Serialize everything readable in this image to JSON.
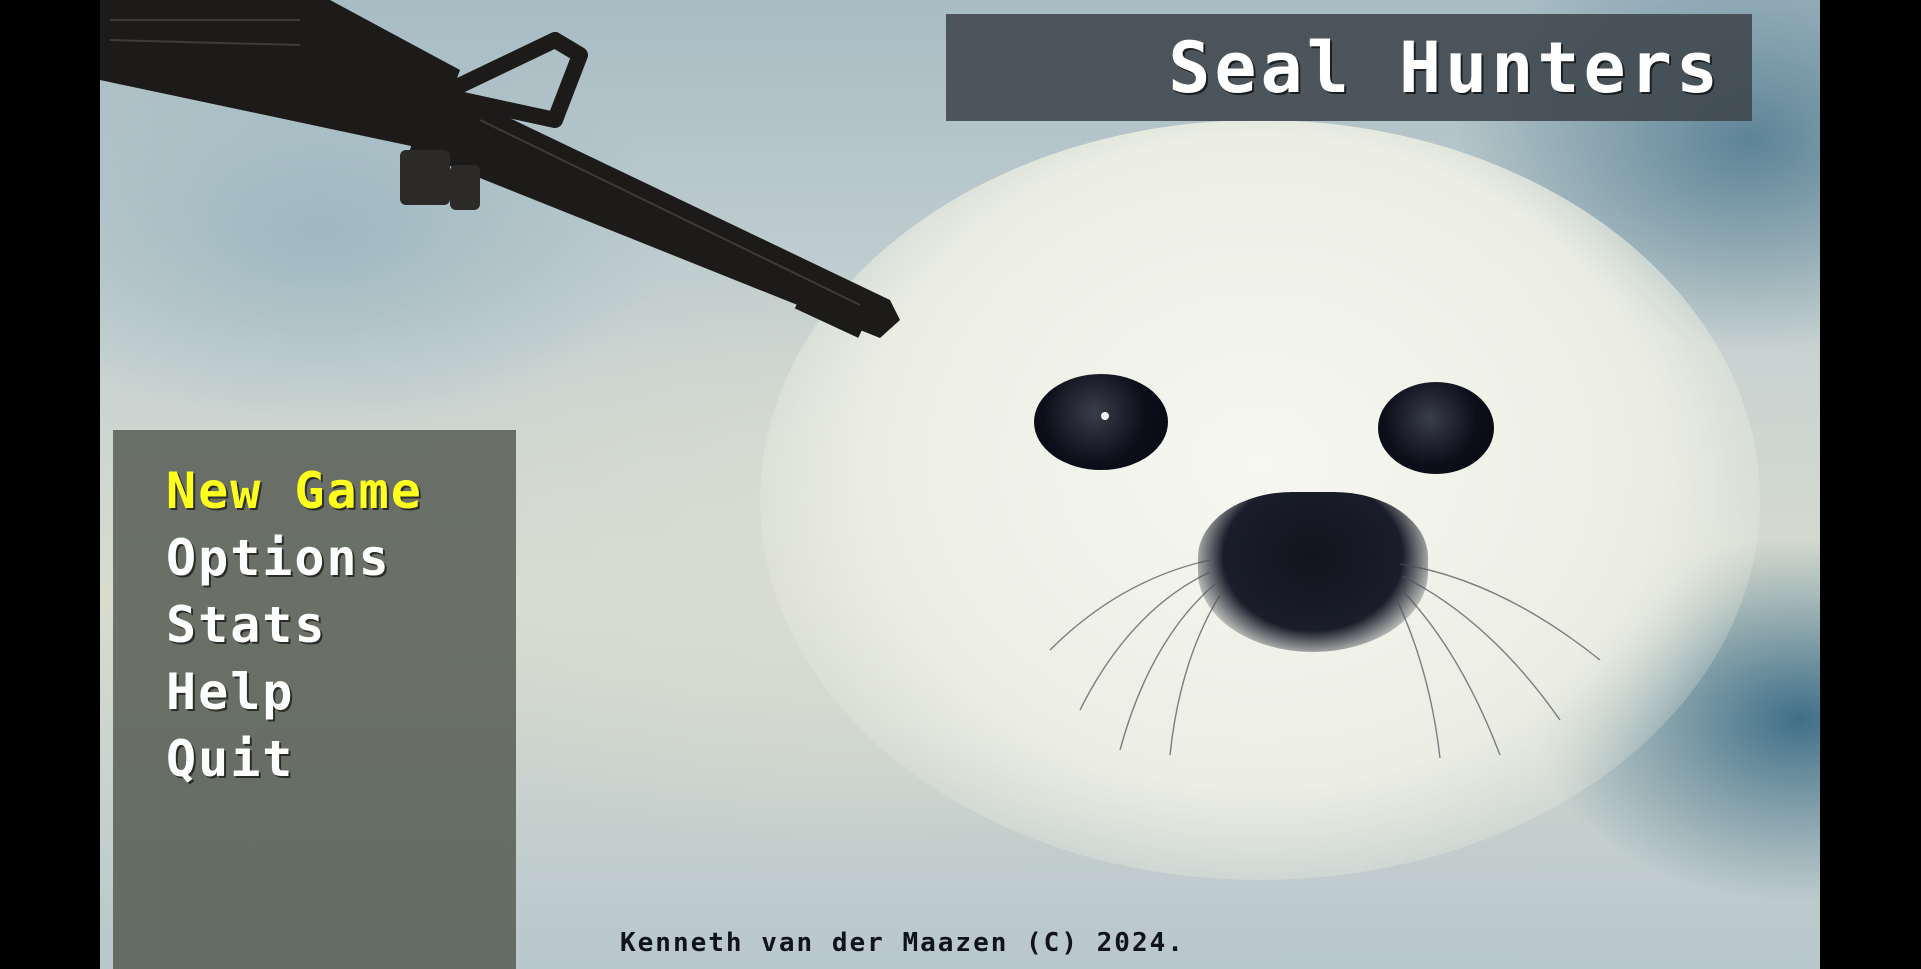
{
  "game": {
    "title": "Seal Hunters",
    "menu": {
      "items": [
        {
          "label": "New Game",
          "selected": true
        },
        {
          "label": "Options",
          "selected": false
        },
        {
          "label": "Stats",
          "selected": false
        },
        {
          "label": "Help",
          "selected": false
        },
        {
          "label": "Quit",
          "selected": false
        }
      ]
    },
    "footer": "Kenneth van der Maazen (C) 2024."
  },
  "colors": {
    "selected_menu_item": "#ffff1e",
    "menu_item": "#ffffff",
    "title_text": "#ffffff",
    "letterbox": "#000000"
  },
  "icons": {
    "background": "seal-pup-photo",
    "overlay": "rifle-barrel"
  }
}
